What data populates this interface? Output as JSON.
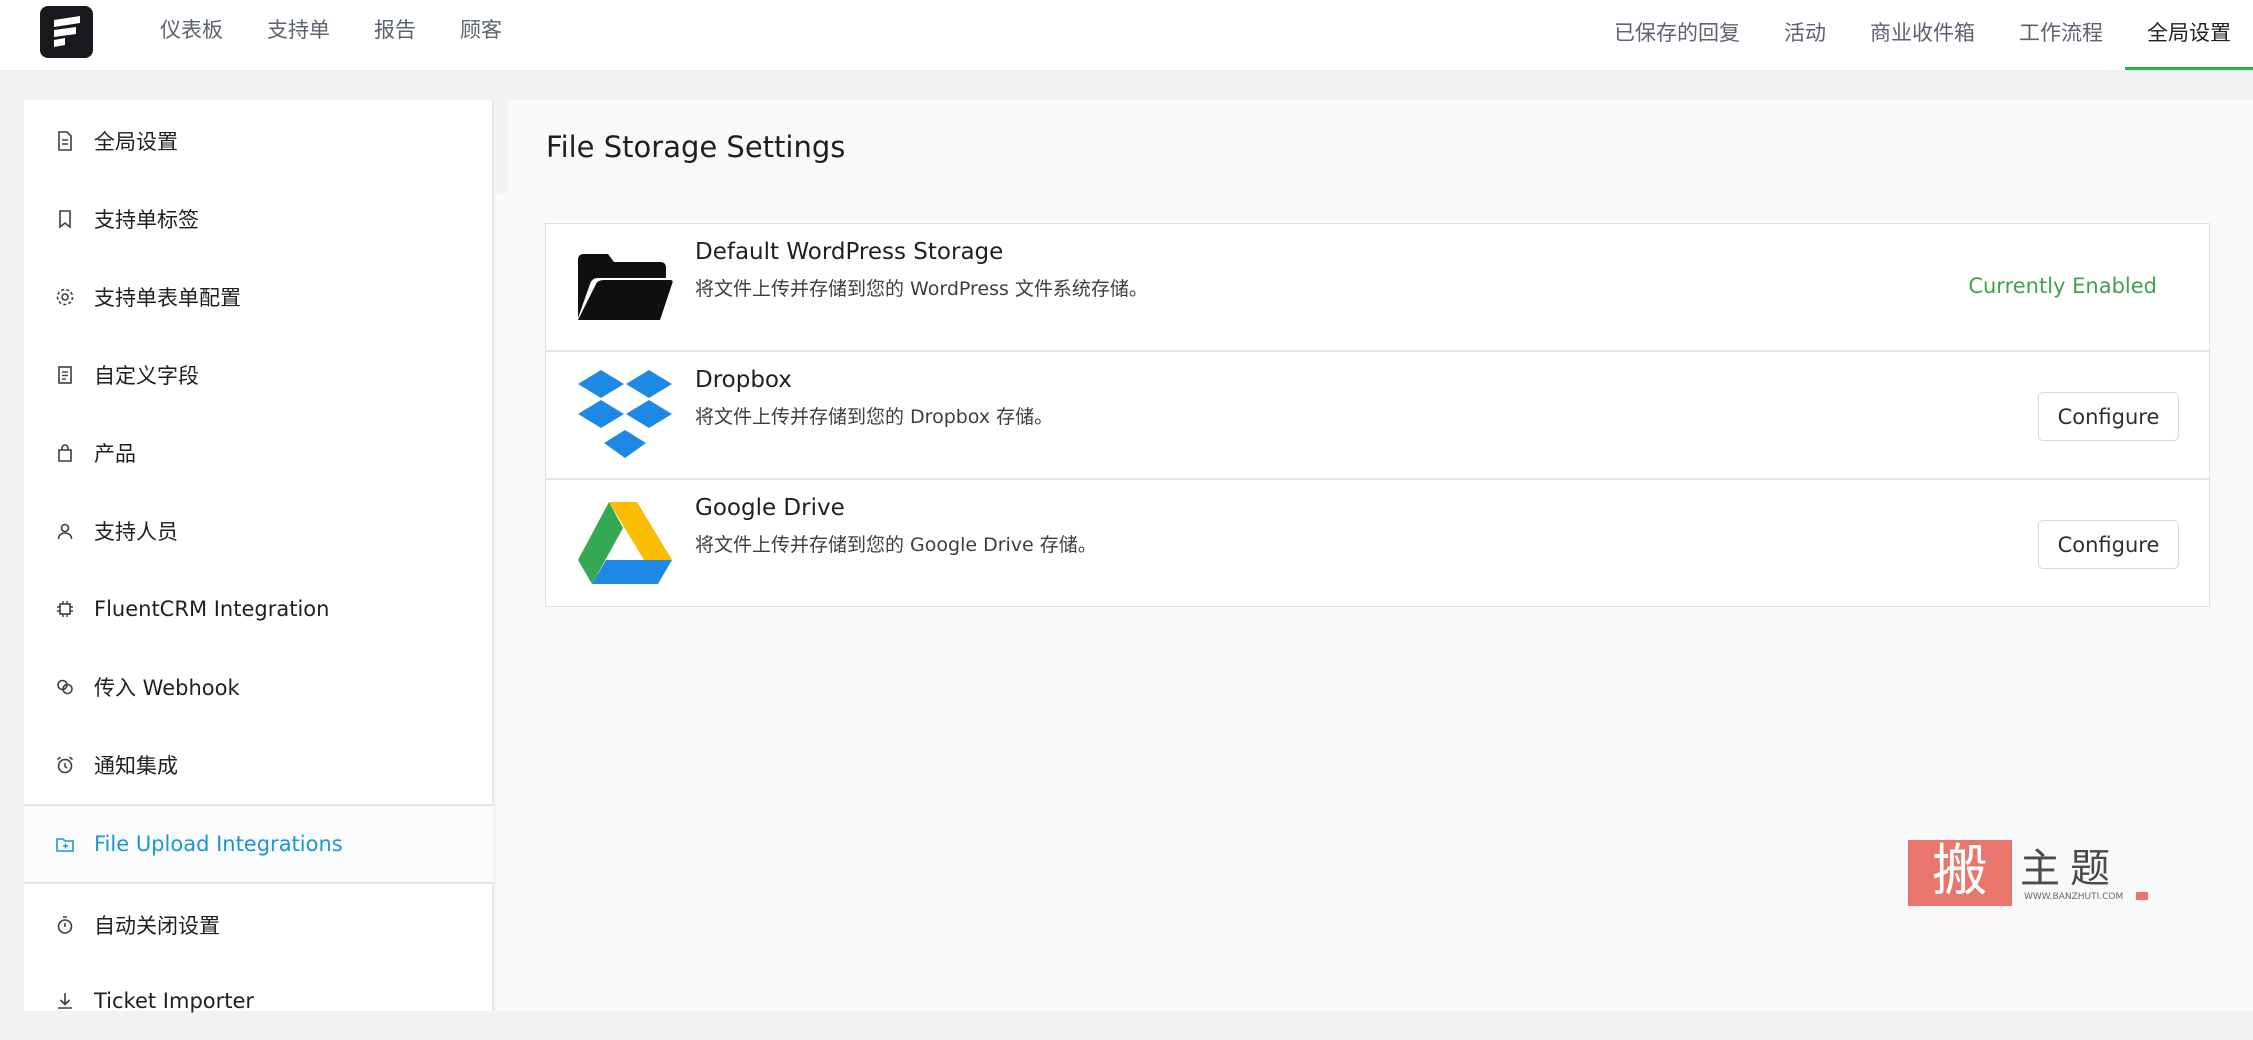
{
  "nav": {
    "left": [
      "仪表板",
      "支持单",
      "报告",
      "顾客"
    ],
    "right": [
      "已保存的回复",
      "活动",
      "商业收件箱",
      "工作流程",
      "全局设置"
    ],
    "active": "全局设置",
    "accent": "#2bb24c"
  },
  "sidebar": {
    "items": [
      {
        "label": "全局设置",
        "icon": "document-icon"
      },
      {
        "label": "支持单标签",
        "icon": "bookmark-icon"
      },
      {
        "label": "支持单表单配置",
        "icon": "gear-icon"
      },
      {
        "label": "自定义字段",
        "icon": "form-icon"
      },
      {
        "label": "产品",
        "icon": "bag-icon"
      },
      {
        "label": "支持人员",
        "icon": "user-icon"
      },
      {
        "label": "FluentCRM Integration",
        "icon": "chip-icon"
      },
      {
        "label": "传入 Webhook",
        "icon": "link-icon"
      },
      {
        "label": "通知集成",
        "icon": "alarm-icon"
      },
      {
        "label": "File Upload Integrations",
        "icon": "folder-icon"
      },
      {
        "label": "自动关闭设置",
        "icon": "timer-icon"
      },
      {
        "label": "Ticket Importer",
        "icon": "download-icon"
      }
    ],
    "active_index": 9,
    "active_color": "#1a96d3"
  },
  "main": {
    "title": "File Storage Settings",
    "providers": [
      {
        "name": "Default WordPress Storage",
        "desc": "将文件上传并存储到您的 WordPress 文件系统存储。",
        "status": "Currently Enabled",
        "icon": "folder-icon"
      },
      {
        "name": "Dropbox",
        "desc": "将文件上传并存储到您的 Dropbox 存储。",
        "action": "Configure",
        "icon": "dropbox-icon"
      },
      {
        "name": "Google Drive",
        "desc": "将文件上传并存储到您的 Google Drive 存储。",
        "action": "Configure",
        "icon": "google-drive-icon"
      }
    ],
    "status_color": "#3fa34d"
  },
  "watermark": {
    "seal": "搬",
    "text": "主题",
    "url": "WWW.BANZHUTI.COM"
  }
}
